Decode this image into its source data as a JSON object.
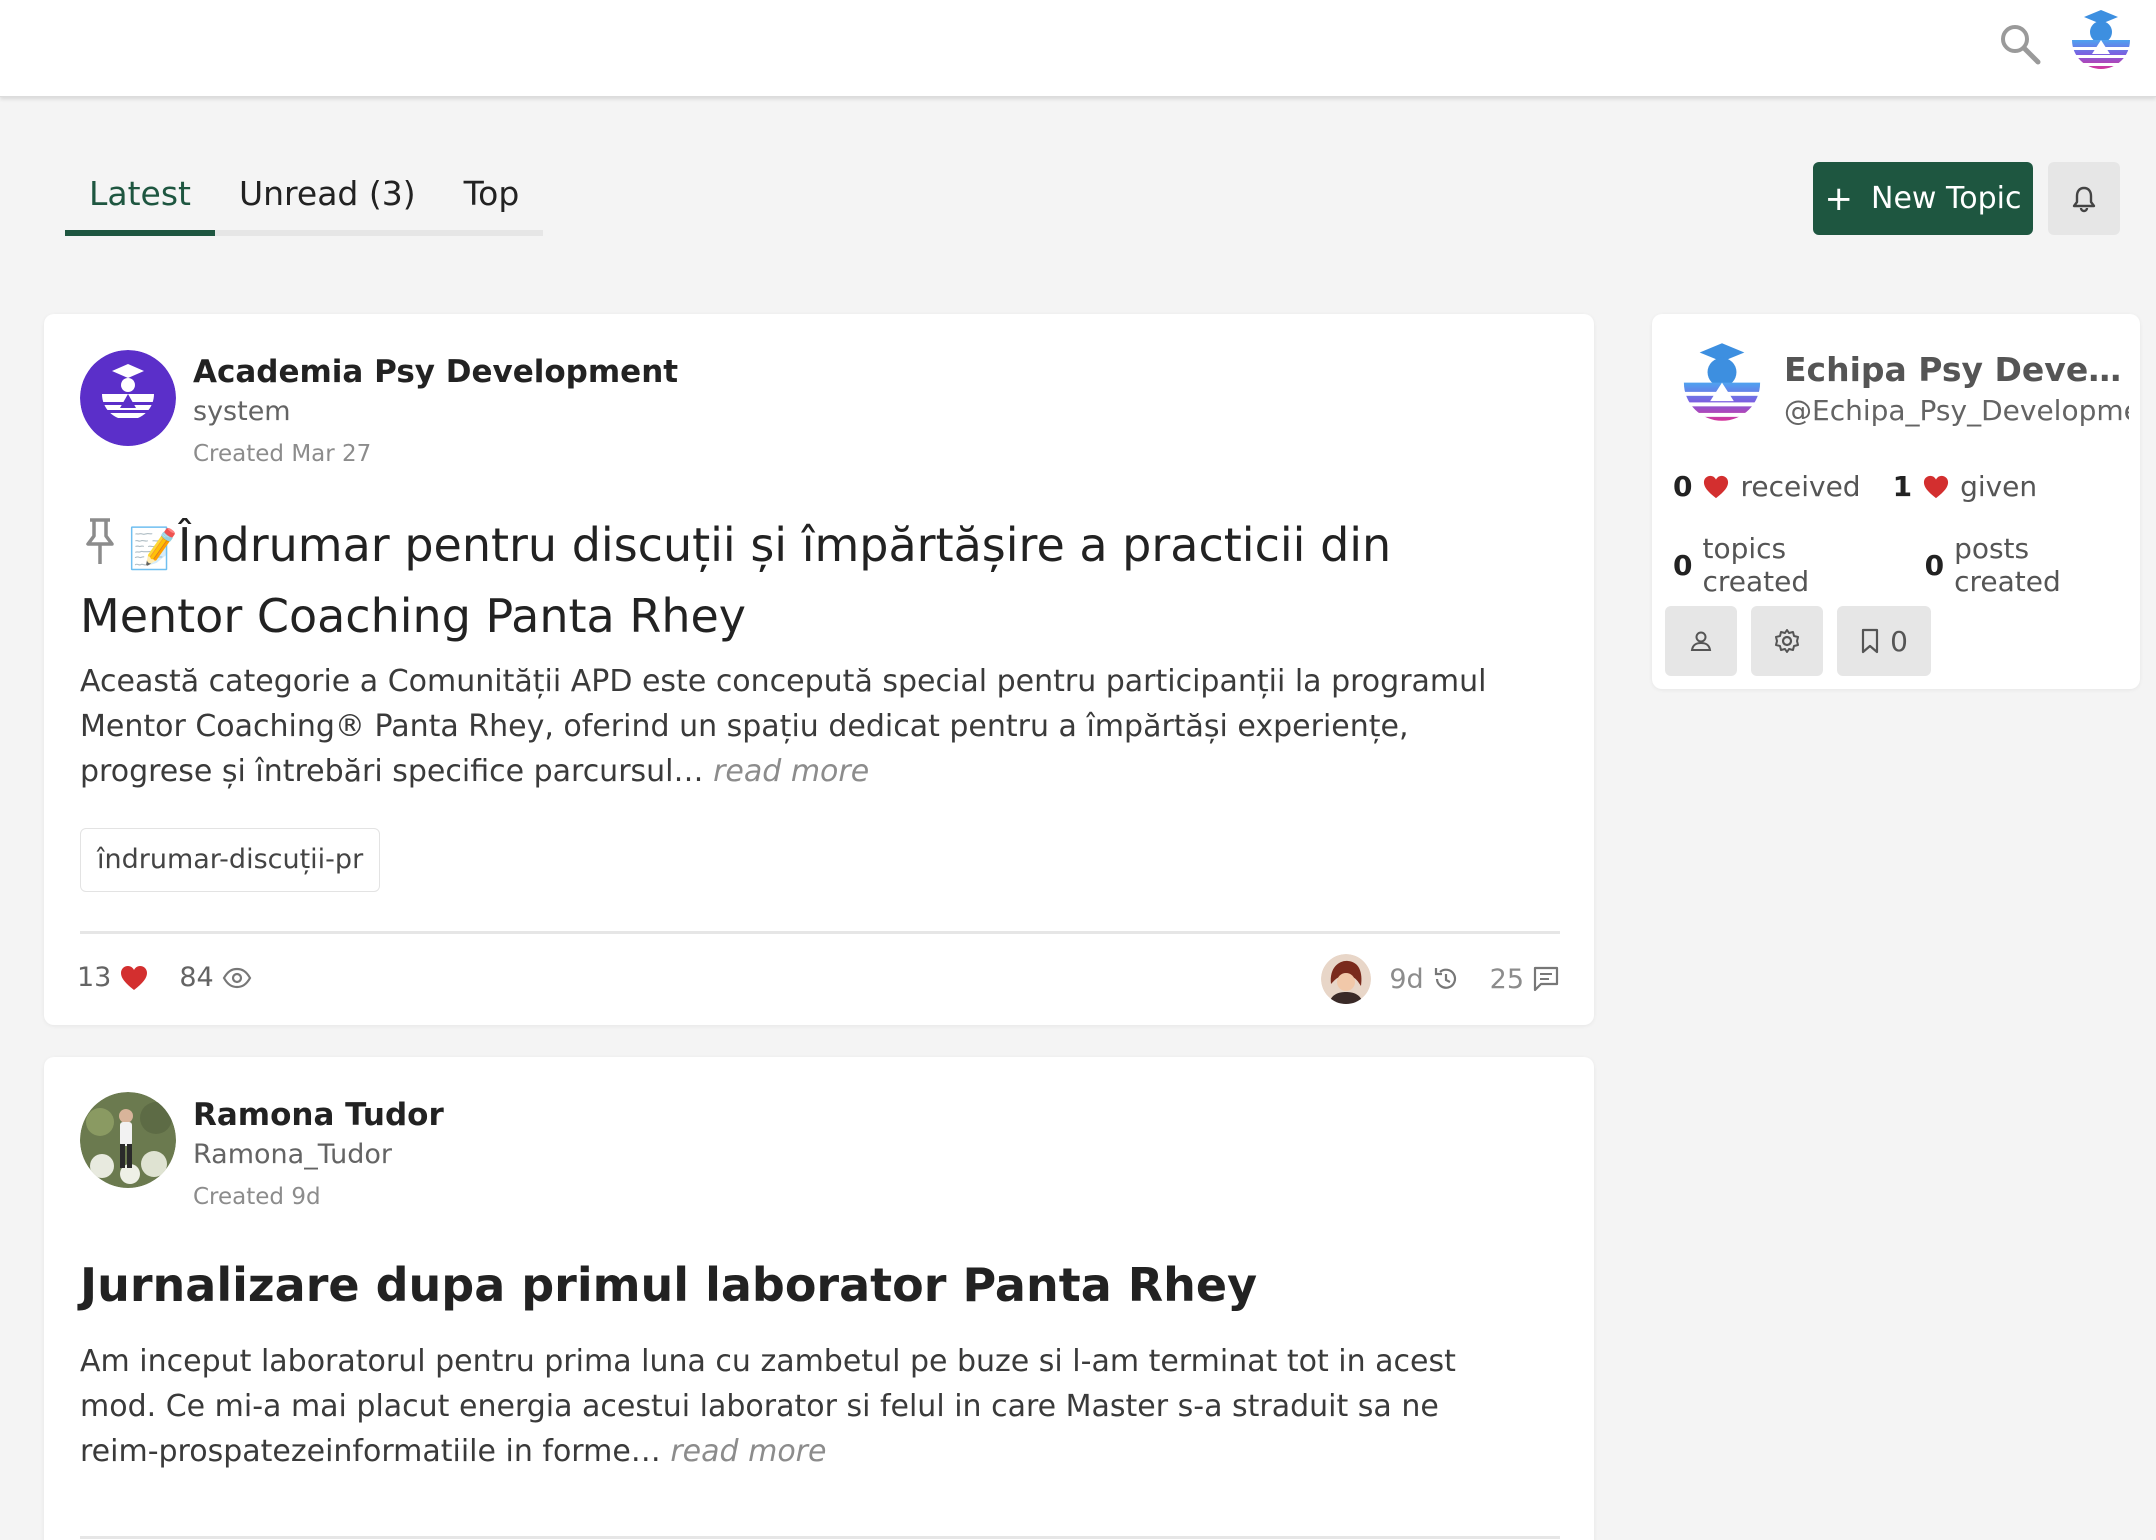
{
  "header": {
    "search_icon": "search-icon",
    "avatar_icon": "academy-logo"
  },
  "nav": {
    "tabs": [
      {
        "label": "Latest",
        "active": true
      },
      {
        "label": "Unread (3)",
        "active": false
      },
      {
        "label": "Top",
        "active": false
      }
    ]
  },
  "actions": {
    "new_topic_label": "New Topic",
    "new_topic_icon": "+",
    "bell_icon": "bell-icon"
  },
  "topics": [
    {
      "author_name": "Academia Psy Development",
      "author_user": "system",
      "created": "Created Mar 27",
      "pinned": true,
      "emoji": "📝",
      "title": "Îndrumar pentru discuții și împărtășire a practicii din Mentor Coaching Panta Rhey",
      "excerpt": "Această categorie a Comunității APD este concepută special pentru participanții la programul Mentor Coaching® Panta Rhey, oferind un spațiu dedicat pentru a împărtăși experiențe, progrese și întrebări specifice parcursul…",
      "read_more": "read more",
      "tag": "îndrumar-discuții-pr",
      "likes": "13",
      "views": "84",
      "last_activity": "9d",
      "replies": "25"
    },
    {
      "author_name": "Ramona Tudor",
      "author_user": "Ramona_Tudor",
      "created": "Created 9d",
      "title": "Jurnalizare dupa primul laborator Panta Rhey",
      "excerpt": "Am inceput laboratorul pentru prima luna cu zambetul pe buze si l-am terminat tot in acest mod. Ce mi-a mai placut energia acestui laborator si felul in care Master s-a straduit sa ne reim-prospatezeinformatiile in forme…",
      "read_more": "read more"
    }
  ],
  "user_card": {
    "name": "Echipa Psy Develop...",
    "handle": "@Echipa_Psy_Developme",
    "received_count": "0",
    "received_label": "received",
    "given_count": "1",
    "given_label": "given",
    "topics_count": "0",
    "topics_label": "topics created",
    "posts_count": "0",
    "posts_label": "posts created",
    "bookmarks_count": "0"
  },
  "colors": {
    "brand_green": "#1e5640",
    "heart_red": "#d32f2f",
    "logo_purple": "#5b2fc9"
  }
}
